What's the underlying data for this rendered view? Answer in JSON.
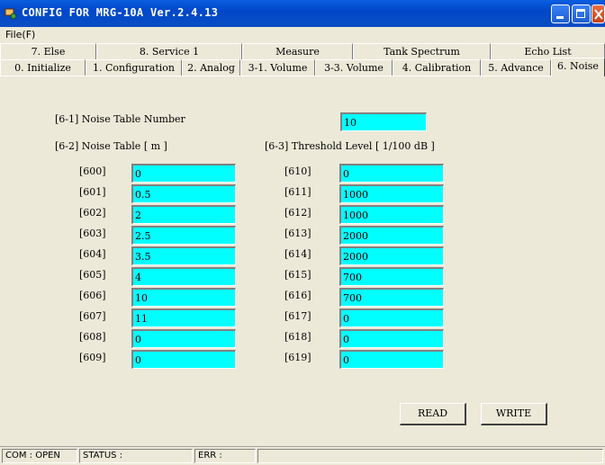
{
  "window": {
    "title": "CONFIG FOR MRG-10A Ver.2.4.13",
    "icon": "app-icon"
  },
  "menubar": {
    "file_label": "File(F)"
  },
  "tabs": {
    "back_row": [
      "7. Else",
      "8. Service 1",
      "Measure",
      "Tank Spectrum",
      "Echo List"
    ],
    "front_row": [
      "0. Initialize",
      "1. Configuration",
      "2. Analog",
      "3-1. Volume",
      "3-3. Volume",
      "4. Calibration",
      "5. Advance",
      "6. Noise"
    ],
    "active": "6. Noise"
  },
  "noise": {
    "table_number_label": "[6-1] Noise Table Number",
    "table_number_value": "10",
    "noise_table_label": "[6-2] Noise Table [ m ]",
    "threshold_label": "[6-3] Threshold Level [ 1/100 dB ]",
    "noise_rows": [
      {
        "id": "[600]",
        "value": "0"
      },
      {
        "id": "[601]",
        "value": "0.5"
      },
      {
        "id": "[602]",
        "value": "2"
      },
      {
        "id": "[603]",
        "value": "2.5"
      },
      {
        "id": "[604]",
        "value": "3.5"
      },
      {
        "id": "[605]",
        "value": "4"
      },
      {
        "id": "[606]",
        "value": "10"
      },
      {
        "id": "[607]",
        "value": "11"
      },
      {
        "id": "[608]",
        "value": "0"
      },
      {
        "id": "[609]",
        "value": "0"
      }
    ],
    "threshold_rows": [
      {
        "id": "[610]",
        "value": "0"
      },
      {
        "id": "[611]",
        "value": "1000"
      },
      {
        "id": "[612]",
        "value": "1000"
      },
      {
        "id": "[613]",
        "value": "2000"
      },
      {
        "id": "[614]",
        "value": "2000"
      },
      {
        "id": "[615]",
        "value": "700"
      },
      {
        "id": "[616]",
        "value": "700"
      },
      {
        "id": "[617]",
        "value": "0"
      },
      {
        "id": "[618]",
        "value": "0"
      },
      {
        "id": "[619]",
        "value": "0"
      }
    ]
  },
  "buttons": {
    "read": "READ",
    "write": "WRITE"
  },
  "status": {
    "com": "COM : OPEN",
    "status": "STATUS :",
    "err": "ERR :"
  },
  "colors": {
    "field_bg": "#00ffff",
    "titlebar": "#0047c8",
    "window_bg": "#ece9d8"
  }
}
